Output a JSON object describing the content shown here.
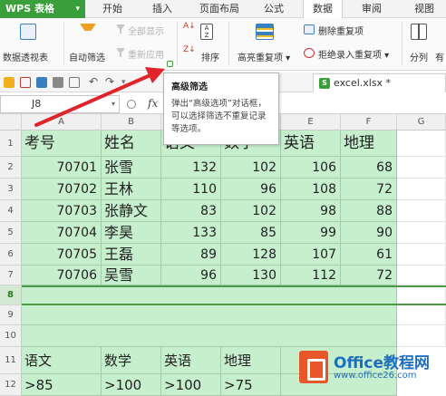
{
  "app": {
    "name": "WPS 表格"
  },
  "tabs": [
    "开始",
    "插入",
    "页面布局",
    "公式",
    "数据",
    "审阅",
    "视图"
  ],
  "active_tab": "数据",
  "ribbon": {
    "pivot": "数据透视表",
    "autofilter": "自动筛选",
    "show_all": "全部显示",
    "reapply": "重新应用",
    "sort": "排序",
    "highlight_dup": "高亮重复项",
    "delete_dup": "删除重复项",
    "reject_dup": "拒绝录入重复项",
    "split": "分列",
    "more": "有"
  },
  "file_tab": "excel.xlsx *",
  "formula_bar": {
    "cell_ref": "J8",
    "fx": "fx",
    "formula": ""
  },
  "tooltip": {
    "title": "高级筛选",
    "body": "弹出“高级选项”对话框，可以选择筛选不重复记录等选项。"
  },
  "columns": [
    "A",
    "B",
    "C",
    "D",
    "E",
    "F",
    "G"
  ],
  "rows": [
    "1",
    "2",
    "3",
    "4",
    "5",
    "6",
    "7",
    "8",
    "9",
    "10",
    "11",
    "12"
  ],
  "table": {
    "headers": [
      "考号",
      "姓名",
      "语文",
      "数学",
      "英语",
      "地理"
    ],
    "data": [
      [
        "70701",
        "张雪",
        "132",
        "102",
        "106",
        "68"
      ],
      [
        "70702",
        "王林",
        "110",
        "96",
        "108",
        "72"
      ],
      [
        "70703",
        "张静文",
        "83",
        "102",
        "98",
        "88"
      ],
      [
        "70704",
        "李昊",
        "133",
        "85",
        "99",
        "90"
      ],
      [
        "70705",
        "王磊",
        "89",
        "128",
        "107",
        "61"
      ],
      [
        "70706",
        "吴雪",
        "96",
        "130",
        "112",
        "72"
      ]
    ]
  },
  "criteria": {
    "headers": [
      "语文",
      "数学",
      "英语",
      "地理"
    ],
    "values": [
      ">85",
      ">100",
      ">100",
      ">75"
    ]
  },
  "watermark": {
    "brand": "Office教程网",
    "url": "www.office26.com"
  },
  "colors": {
    "accent": "#3a9e3a",
    "cell_fill": "#c6efce",
    "arrow": "#e0242c"
  }
}
